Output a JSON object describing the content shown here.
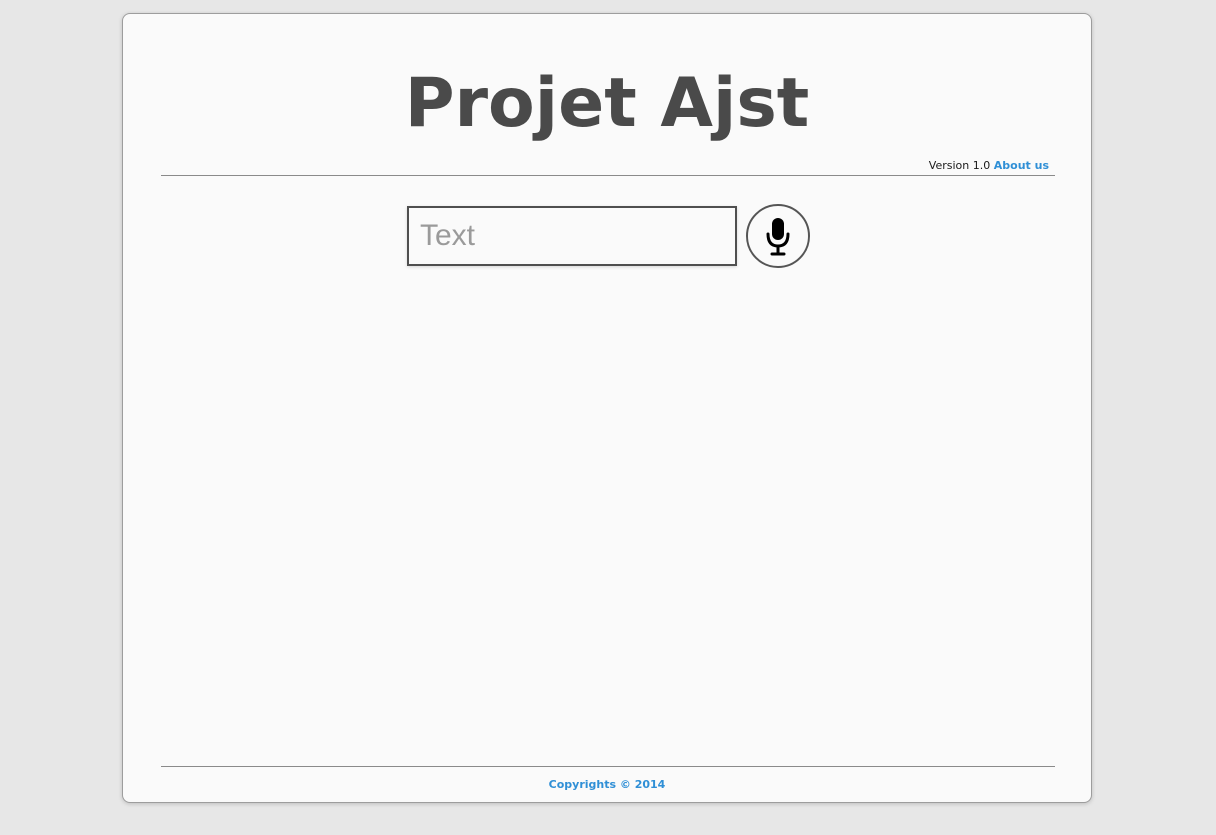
{
  "header": {
    "title": "Projet Ajst",
    "version_label": "Version 1.0",
    "about_link": "About us"
  },
  "search": {
    "placeholder": "Text",
    "value": ""
  },
  "mic_button": {
    "icon": "microphone-icon"
  },
  "footer": {
    "copyright": "Copyrights © 2014"
  },
  "colors": {
    "background": "#e7e7e7",
    "card": "#fafafa",
    "title": "#4a4a4a",
    "link": "#2f8fd6"
  }
}
